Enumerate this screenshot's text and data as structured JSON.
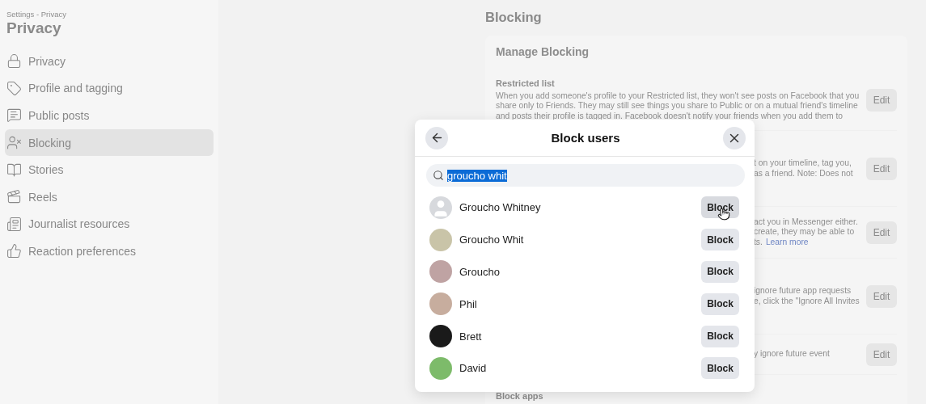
{
  "sidebar": {
    "breadcrumb": "Settings - Privacy",
    "title": "Privacy",
    "items": [
      {
        "label": "Privacy",
        "selected": false
      },
      {
        "label": "Profile and tagging",
        "selected": false
      },
      {
        "label": "Public posts",
        "selected": false
      },
      {
        "label": "Blocking",
        "selected": true
      },
      {
        "label": "Stories",
        "selected": false
      },
      {
        "label": "Reels",
        "selected": false
      },
      {
        "label": "Journalist resources",
        "selected": false
      },
      {
        "label": "Reaction preferences",
        "selected": false
      }
    ]
  },
  "main": {
    "heading": "Blocking",
    "card_title": "Manage Blocking",
    "sections": [
      {
        "kind": "full",
        "title": "Restricted list",
        "lines": [
          {
            "text": "When you add someone's profile to your Restricted list, they won't see posts on Facebook that you"
          },
          {
            "text": "share only to Friends. They may still see things you share to Public or on a mutual friend's timeline"
          },
          {
            "text": "and posts their profile is tagged in. Facebook doesn't notify your friends when you add them to"
          }
        ],
        "button": "Edit"
      },
      {
        "kind": "partial",
        "lines": [
          {
            "text": "t on your timeline, tag you,"
          },
          {
            "text": "as a friend. Note: Does not"
          }
        ],
        "button": "Edit"
      },
      {
        "kind": "partial",
        "lines": [
          {
            "text": "act you in Messenger either."
          },
          {
            "text": "create, they may be able to"
          },
          {
            "text": "ts.",
            "link": "Learn more"
          }
        ],
        "button": "Edit"
      },
      {
        "kind": "partial",
        "lines": [
          {
            "text": "ignore future app requests"
          },
          {
            "text": "e, click the \"Ignore All Invites"
          }
        ],
        "button": "Edit"
      },
      {
        "kind": "partial",
        "lines": [
          {
            "text": "y ignore future event"
          }
        ],
        "button": "Edit"
      },
      {
        "kind": "full",
        "title": "Block apps"
      }
    ]
  },
  "dialog": {
    "title": "Block users",
    "search": {
      "value": "groucho whit",
      "text_selected": true
    },
    "users": [
      {
        "name": "Groucho Whitney",
        "kind": "silhouette",
        "button": "Block",
        "hovered": true
      },
      {
        "name": "Groucho Whit",
        "kind": "photo",
        "color": "#c9c4a8",
        "button": "Block",
        "hovered": false
      },
      {
        "name": "Groucho",
        "kind": "photo",
        "color": "#bfa3a3",
        "button": "Block",
        "hovered": false
      },
      {
        "name": "Phil",
        "kind": "photo",
        "color": "#c7ad9e",
        "button": "Block",
        "hovered": false
      },
      {
        "name": "Brett",
        "kind": "photo",
        "color": "#1a1a1a",
        "button": "Block",
        "hovered": false
      },
      {
        "name": "David",
        "kind": "photo",
        "color": "#7dbb6a",
        "button": "Block",
        "hovered": false
      }
    ]
  }
}
